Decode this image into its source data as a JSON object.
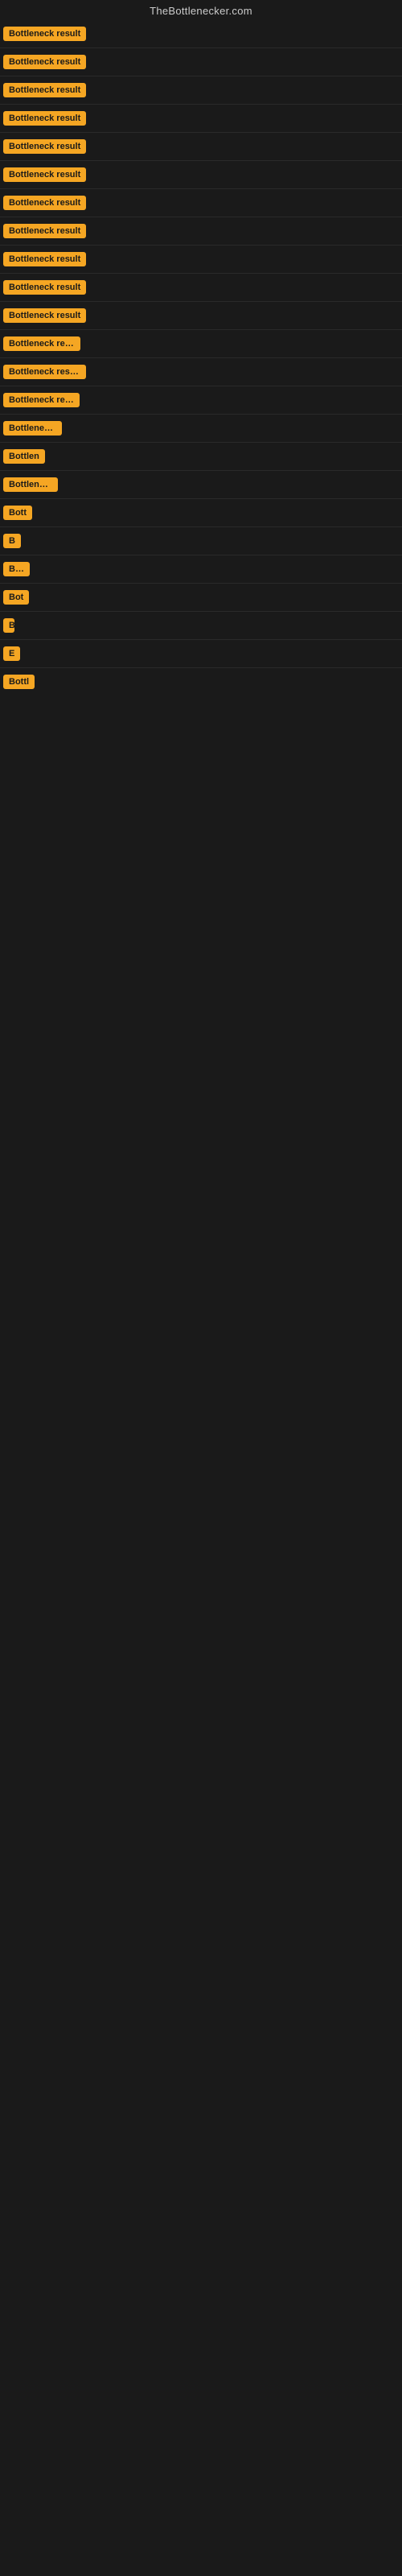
{
  "site": {
    "title": "TheBottlenecker.com"
  },
  "rows": [
    {
      "id": 1,
      "label": "Bottleneck result",
      "class": "row-1"
    },
    {
      "id": 2,
      "label": "Bottleneck result",
      "class": "row-2"
    },
    {
      "id": 3,
      "label": "Bottleneck result",
      "class": "row-3"
    },
    {
      "id": 4,
      "label": "Bottleneck result",
      "class": "row-4"
    },
    {
      "id": 5,
      "label": "Bottleneck result",
      "class": "row-5"
    },
    {
      "id": 6,
      "label": "Bottleneck result",
      "class": "row-6"
    },
    {
      "id": 7,
      "label": "Bottleneck result",
      "class": "row-7"
    },
    {
      "id": 8,
      "label": "Bottleneck result",
      "class": "row-8"
    },
    {
      "id": 9,
      "label": "Bottleneck result",
      "class": "row-9"
    },
    {
      "id": 10,
      "label": "Bottleneck result",
      "class": "row-10"
    },
    {
      "id": 11,
      "label": "Bottleneck result",
      "class": "row-11"
    },
    {
      "id": 12,
      "label": "Bottleneck resu",
      "class": "row-12"
    },
    {
      "id": 13,
      "label": "Bottleneck result",
      "class": "row-13"
    },
    {
      "id": 14,
      "label": "Bottleneck resu",
      "class": "row-14"
    },
    {
      "id": 15,
      "label": "Bottleneck r",
      "class": "row-15"
    },
    {
      "id": 16,
      "label": "Bottlen",
      "class": "row-16"
    },
    {
      "id": 17,
      "label": "Bottleneck",
      "class": "row-17"
    },
    {
      "id": 18,
      "label": "Bott",
      "class": "row-18"
    },
    {
      "id": 19,
      "label": "B",
      "class": "row-19"
    },
    {
      "id": 20,
      "label": "Bottle",
      "class": "row-20"
    },
    {
      "id": 21,
      "label": "Bot",
      "class": "row-21"
    },
    {
      "id": 22,
      "label": "Bottlen",
      "class": "row-22"
    },
    {
      "id": 23,
      "label": "E",
      "class": "row-23"
    },
    {
      "id": 24,
      "label": "Bottl",
      "class": "row-24"
    }
  ]
}
